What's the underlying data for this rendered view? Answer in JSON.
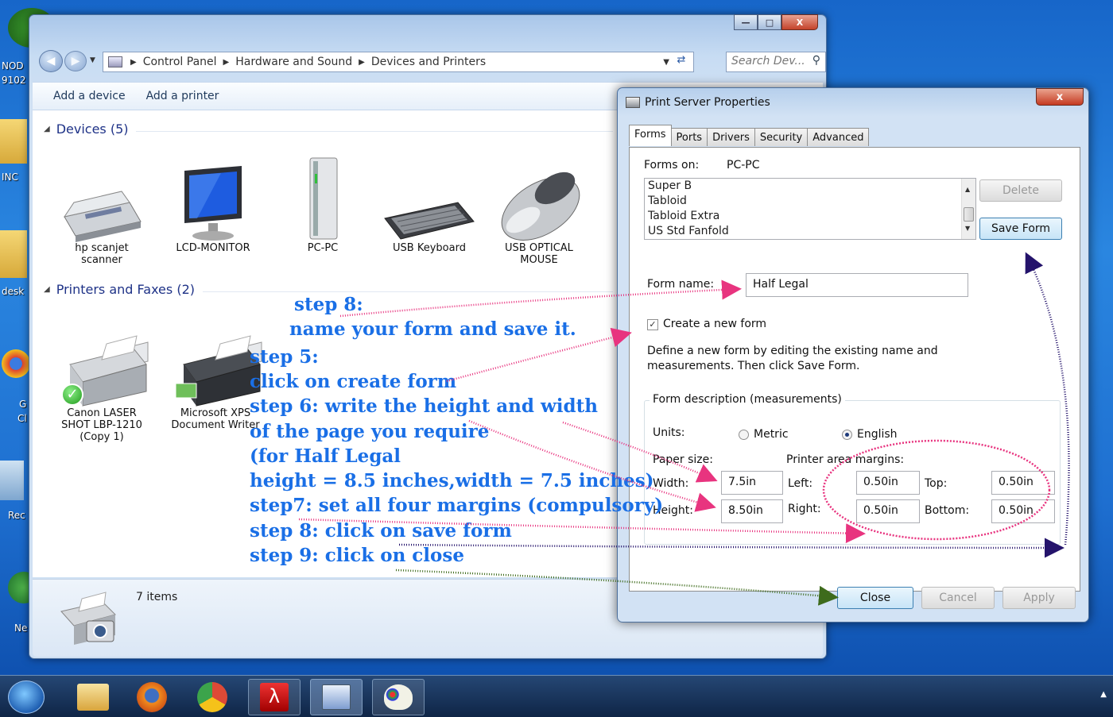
{
  "desktop": {
    "labels": [
      "NOD",
      "9102",
      "INC",
      "desk",
      "G",
      "Cl",
      "Rec",
      "Ne"
    ]
  },
  "explorer": {
    "breadcrumb": [
      "Control Panel",
      "Hardware and Sound",
      "Devices and Printers"
    ],
    "search_placeholder": "Search Dev...",
    "toolbar": {
      "add_device": "Add a device",
      "add_printer": "Add a printer"
    },
    "devices_header": "Devices (5)",
    "devices": [
      {
        "line1": "hp scanjet",
        "line2": "scanner"
      },
      {
        "line1": "LCD-MONITOR",
        "line2": ""
      },
      {
        "line1": "PC-PC",
        "line2": ""
      },
      {
        "line1": "USB Keyboard",
        "line2": ""
      },
      {
        "line1": "USB OPTICAL",
        "line2": "MOUSE"
      }
    ],
    "printers_header": "Printers and Faxes (2)",
    "printers": [
      {
        "line1": "Canon LASER",
        "line2": "SHOT LBP-1210",
        "line3": "(Copy 1)"
      },
      {
        "line1": "Microsoft XPS",
        "line2": "Document Writer",
        "line3": ""
      }
    ],
    "status_items": "7 items"
  },
  "dialog": {
    "title": "Print Server Properties",
    "close_glyph": "x",
    "tabs": [
      "Forms",
      "Ports",
      "Drivers",
      "Security",
      "Advanced"
    ],
    "forms_on_label": "Forms on:",
    "forms_on_value": "PC-PC",
    "forms_list": [
      "Super B",
      "Tabloid",
      "Tabloid Extra",
      "US Std Fanfold"
    ],
    "delete_label": "Delete",
    "save_form_label": "Save Form",
    "form_name_label": "Form name:",
    "form_name_value": "Half Legal",
    "create_new_form_label": "Create a new form",
    "create_new_form_checked": true,
    "description_line1": "Define a new form by editing the existing name and",
    "description_line2": "measurements. Then click Save Form.",
    "group_title": "Form description (measurements)",
    "units_label": "Units:",
    "metric_label": "Metric",
    "english_label": "English",
    "units_selected": "English",
    "paper_size_label": "Paper size:",
    "printer_area_margins_label": "Printer area margins:",
    "width_label": "Width:",
    "width_value": "7.5in",
    "height_label": "Height:",
    "height_value": "8.50in",
    "left_label": "Left:",
    "left_value": "0.50in",
    "right_label": "Right:",
    "right_value": "0.50in",
    "top_label": "Top:",
    "top_value": "0.50in",
    "bottom_label": "Bottom:",
    "bottom_value": "0.50in",
    "close_label": "Close",
    "cancel_label": "Cancel",
    "apply_label": "Apply"
  },
  "annotations": [
    "step 8:",
    "name your form and save it.",
    "step 5:",
    "click on create form",
    "step 6: write the height and width",
    "of the page you require",
    "(for Half Legal",
    "height = 8.5 inches,width = 7.5 inches)",
    "step7: set all four margins (compulsory)",
    "step 8: click on save form",
    "step 9: click on close"
  ],
  "colors": {
    "annotation_text": "#1a6fe6",
    "arrow_pink": "#e8347f",
    "arrow_navy": "#24136b",
    "arrow_green": "#3e6b1c"
  }
}
